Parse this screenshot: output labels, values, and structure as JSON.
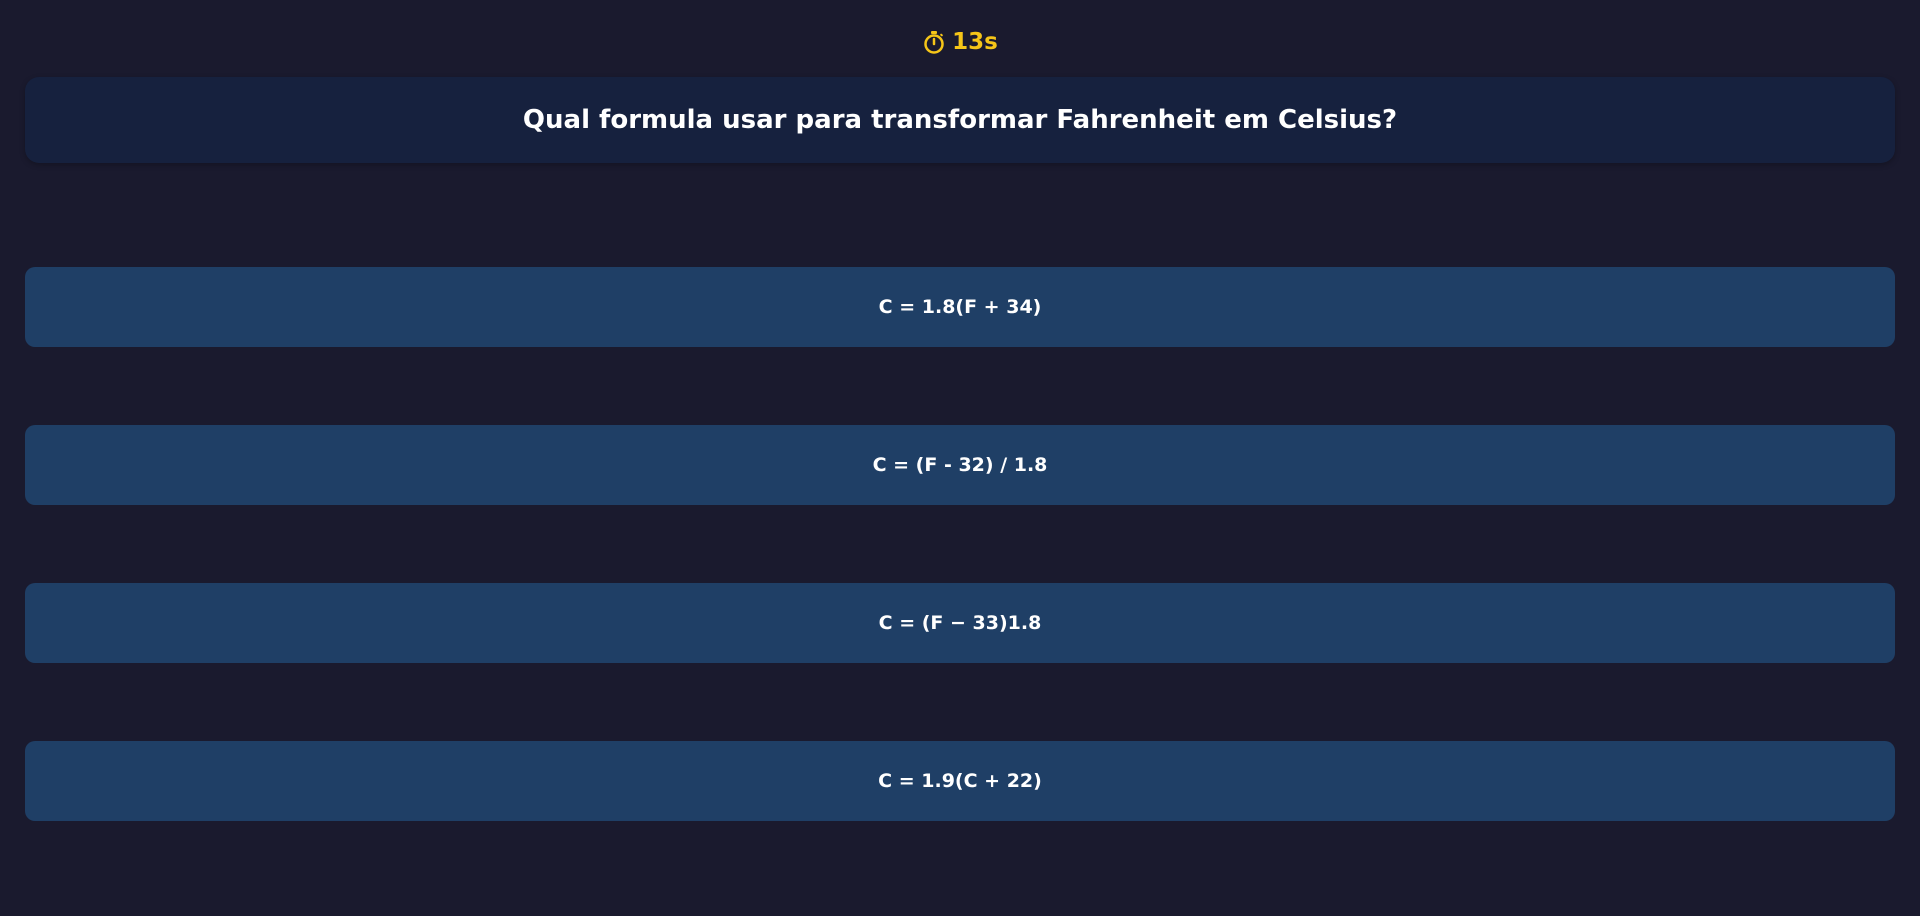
{
  "timer": {
    "icon": "stopwatch-icon",
    "text": "13s",
    "color": "#f5c518"
  },
  "question": {
    "text": "Qual formula usar para transformar Fahrenheit em Celsius?"
  },
  "options": [
    {
      "label": "C = 1.8(F + 34)"
    },
    {
      "label": "C = (F - 32) / 1.8"
    },
    {
      "label": "C = (F − 33)1.8"
    },
    {
      "label": "C = 1.9(C + 22)"
    }
  ],
  "colors": {
    "background": "#1a1a2e",
    "question_card": "#16213e",
    "option_button": "#1f3f66",
    "text": "#ffffff"
  }
}
